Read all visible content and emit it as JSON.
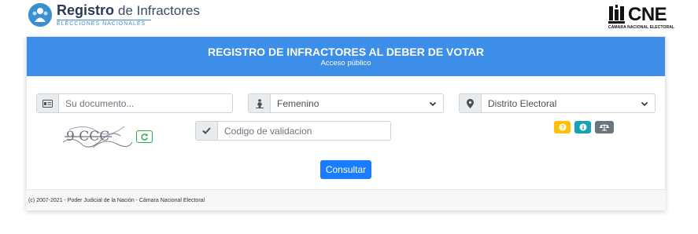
{
  "brand": {
    "title_bold": "Registro",
    "title_light": "de Infractores",
    "subtitle": "ELECCIONES NACIONALES",
    "cne_letters": "CNE",
    "cne_sub": "CÁMARA NACIONAL ELECTORAL",
    "accent": "#3d8ee8"
  },
  "card": {
    "title": "REGISTRO DE INFRACTORES AL DEBER DE VOTAR",
    "subtitle": "Acceso público"
  },
  "form": {
    "documento": {
      "placeholder": "Su documento...",
      "icon": "id-card-icon"
    },
    "sexo": {
      "selected": "Femenino",
      "icon": "person-icon"
    },
    "distrito": {
      "selected": "Distrito Electoral",
      "icon": "map-marker-icon"
    },
    "validacion": {
      "placeholder": "Codigo de validacion",
      "icon": "check-icon"
    },
    "captcha_text": "9 CCC",
    "submit_label": "Consultar"
  },
  "actions": {
    "help": {
      "icon": "question-icon",
      "color": "#ffc107"
    },
    "info": {
      "icon": "info-icon",
      "color": "#17a2b8"
    },
    "legal": {
      "icon": "balance-scale-icon",
      "color": "#6c757d"
    }
  },
  "footer": {
    "text": "(c) 2007-2021 - Poder Judicial de la Nación - Cámara Nacional Electoral"
  }
}
